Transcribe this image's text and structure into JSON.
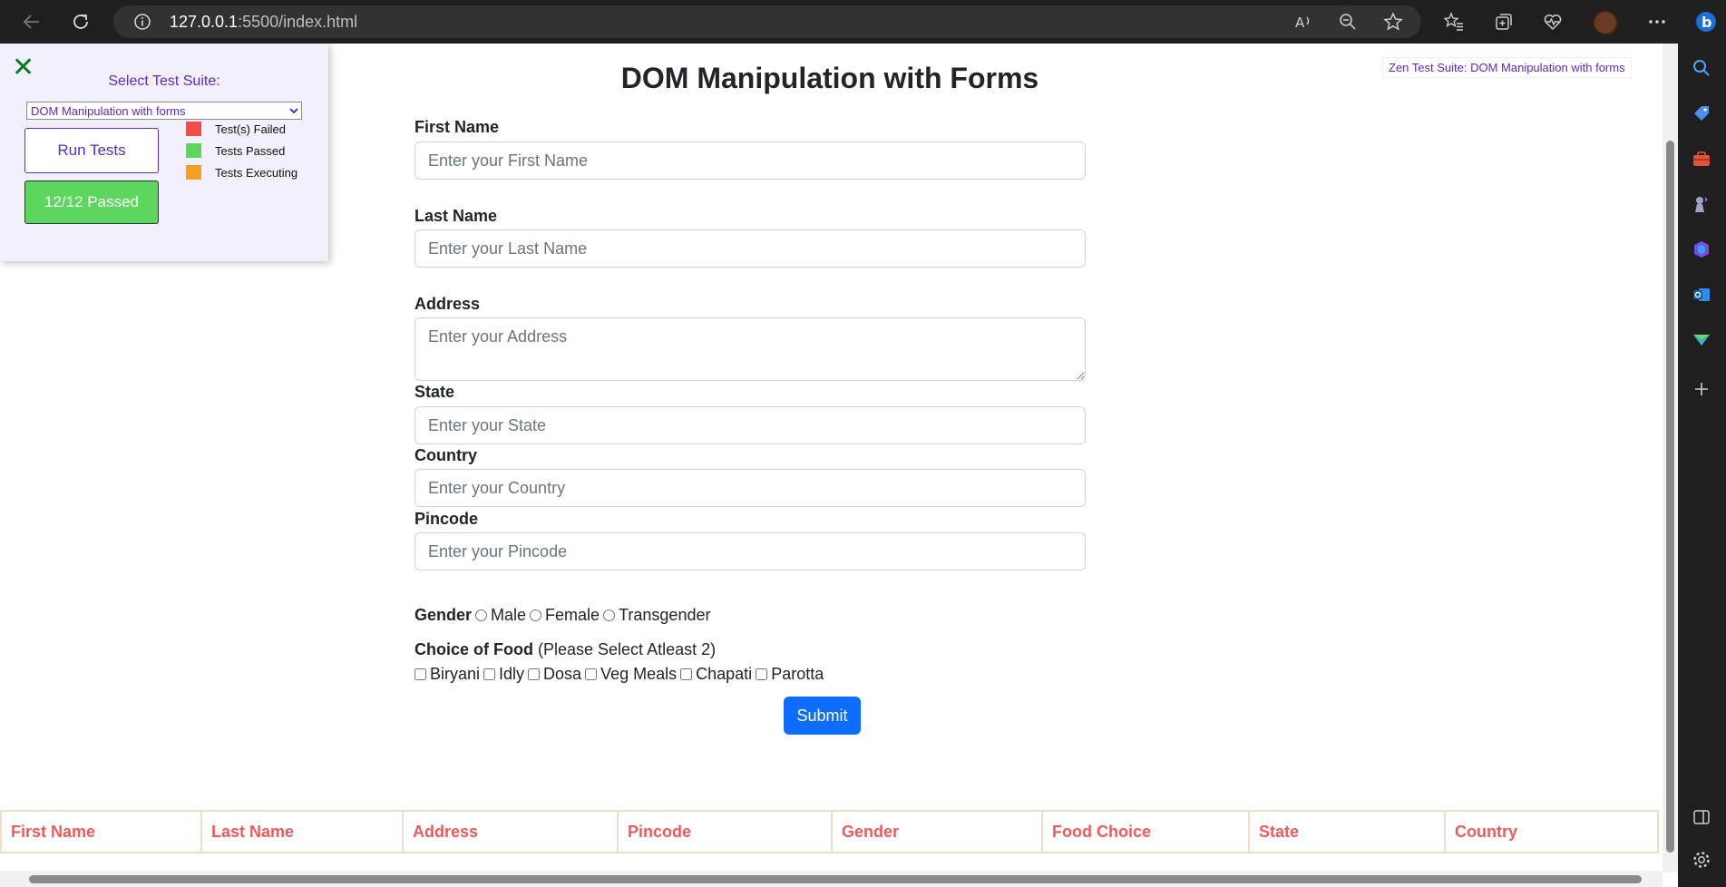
{
  "browser": {
    "url_host": "127.0.0.1",
    "url_path": ":5500/index.html"
  },
  "test_panel": {
    "close_glyph": "✕",
    "select_label": "Select Test Suite:",
    "selected_suite": "DOM Manipulation with forms",
    "run_button": "Run Tests",
    "result_button": "12/12 Passed",
    "legend": [
      {
        "label": "Test(s) Failed",
        "color": "#f44a4a"
      },
      {
        "label": "Tests Passed",
        "color": "#5cd65c"
      },
      {
        "label": "Tests Executing",
        "color": "#f5a020"
      }
    ]
  },
  "suite_badge": "Zen Test Suite: DOM Manipulation with forms",
  "form": {
    "title": "DOM Manipulation with Forms",
    "first_name": {
      "label": "First Name",
      "placeholder": "Enter your First Name"
    },
    "last_name": {
      "label": "Last Name",
      "placeholder": "Enter your Last Name"
    },
    "address": {
      "label": "Address",
      "placeholder": "Enter your Address"
    },
    "state": {
      "label": "State",
      "placeholder": "Enter your State"
    },
    "country": {
      "label": "Country",
      "placeholder": "Enter your Country"
    },
    "pincode": {
      "label": "Pincode",
      "placeholder": "Enter your Pincode"
    },
    "gender": {
      "label": "Gender",
      "options": [
        "Male",
        "Female",
        "Transgender"
      ]
    },
    "food": {
      "label": "Choice of Food",
      "hint": "(Please Select Atleast 2)",
      "options": [
        "Biryani",
        "Idly",
        "Dosa",
        "Veg Meals",
        "Chapati",
        "Parotta"
      ]
    },
    "submit": "Submit"
  },
  "table": {
    "headers": [
      "First Name",
      "Last Name",
      "Address",
      "Pincode",
      "Gender",
      "Food Choice",
      "State",
      "Country"
    ]
  },
  "colors": {
    "accent": "#5b2bc4",
    "submit_bg": "#0d6efd",
    "table_header_text": "#f05a5a"
  }
}
